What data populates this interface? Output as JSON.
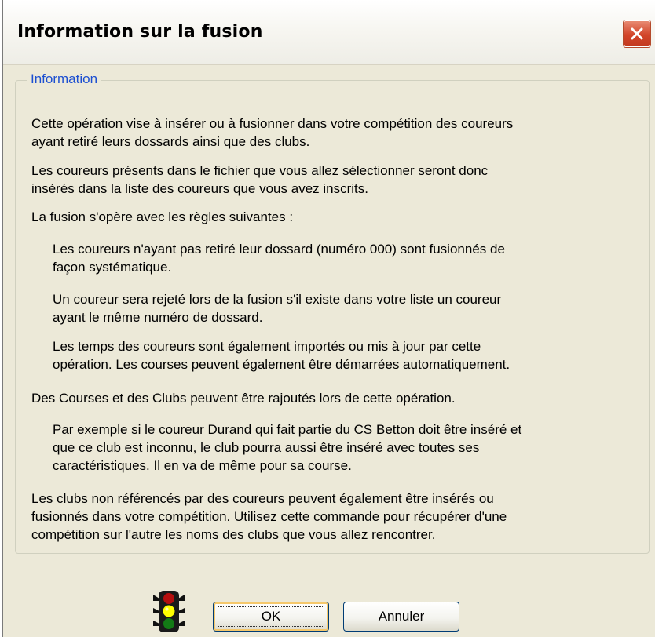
{
  "window": {
    "title": "Information sur la fusion"
  },
  "group": {
    "legend": "Information"
  },
  "paragraphs": [
    {
      "text": "Cette opération vise à insérer ou à fusionner dans votre compétition des coureurs\nayant retiré leurs dossards ainsi que des clubs.",
      "indent": false
    },
    {
      "text": "Les coureurs présents dans le fichier que vous allez sélectionner seront donc\ninsérés dans la liste des coureurs que vous avez inscrits.",
      "indent": false
    },
    {
      "text": "La fusion s'opère avec les règles suivantes :",
      "indent": false
    },
    {
      "text": "Les coureurs n'ayant pas retiré leur dossard (numéro 000) sont fusionnés de\nfaçon systématique.",
      "indent": true
    },
    {
      "text": "Un coureur sera rejeté lors de la fusion s'il existe dans votre liste un coureur\nayant le même numéro de dossard.",
      "indent": true
    },
    {
      "text": "Les temps des coureurs sont également importés ou mis à jour par cette\nopération. Les courses peuvent également être démarrées automatiquement.",
      "indent": true
    },
    {
      "text": "Des Courses et des Clubs peuvent être rajoutés lors de cette opération.",
      "indent": false
    },
    {
      "text": "Par exemple si le coureur Durand qui fait partie du CS Betton doit être inséré et\nque ce club est inconnu, le club pourra aussi être inséré avec toutes ses\ncaractéristiques. Il en va de même pour sa course.",
      "indent": true
    },
    {
      "text": "Les clubs non référencés par des coureurs peuvent également être insérés ou\nfusionnés dans votre compétition. Utilisez cette commande pour récupérer d'une\ncompétition sur l'autre les noms des clubs que vous allez rencontrer.",
      "indent": false
    }
  ],
  "buttons": {
    "ok": "OK",
    "cancel": "Annuler"
  },
  "icons": {
    "close": "close-icon",
    "status": "traffic-light-icon"
  },
  "colors": {
    "legend": "#1c4fd1",
    "close_button": "#d2452a",
    "dialog_bg": "#ece9d8"
  }
}
